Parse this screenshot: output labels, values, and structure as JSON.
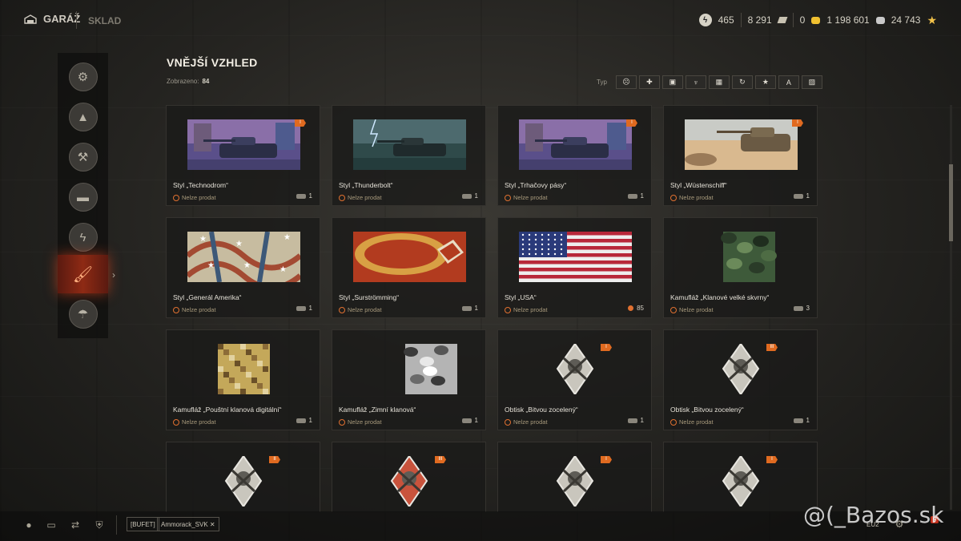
{
  "topbar": {
    "garage_label": "GARÁŽ",
    "storage_label": "SKLAD",
    "free_xp": "465",
    "bonds": "8 291",
    "credits_icon_value": "0",
    "gold": "1 198 601",
    "silver": "24 743"
  },
  "sidebar": {
    "items": [
      {
        "icon": "consumables-icon",
        "glyph": "⚙"
      },
      {
        "icon": "shells-icon",
        "glyph": "▲"
      },
      {
        "icon": "equipment-icon",
        "glyph": "⚒"
      },
      {
        "icon": "tank-icon",
        "glyph": "▬"
      },
      {
        "icon": "directive-icon",
        "glyph": "ϟ"
      },
      {
        "icon": "customization-brush-icon",
        "glyph": "🖌"
      },
      {
        "icon": "crew-parachute-icon",
        "glyph": "☂"
      }
    ],
    "active_index": 5
  },
  "main": {
    "title": "VNĚJŠÍ VZHLED",
    "shown_label": "Zobrazeno:",
    "shown_count": "84",
    "filter_label": "Typ",
    "filters": [
      "☹",
      "✚",
      "▣",
      "♆",
      "▦",
      "↻",
      "★",
      "A",
      "▨"
    ]
  },
  "cards": [
    {
      "name": "Styl „Technodrom“",
      "sell": "Nelze prodat",
      "count": "1",
      "badge": "I",
      "art": "tank-blue"
    },
    {
      "name": "Styl „Thunderbolt“",
      "sell": "Nelze prodat",
      "count": "1",
      "badge": "",
      "art": "storm"
    },
    {
      "name": "Styl „Trhačovy pásy“",
      "sell": "Nelze prodat",
      "count": "1",
      "badge": "I",
      "art": "tank-blue"
    },
    {
      "name": "Styl „Wüstenschiff“",
      "sell": "Nelze prodat",
      "count": "1",
      "badge": "I",
      "art": "desert"
    },
    {
      "name": "Styl „Generál Amerika“",
      "sell": "Nelze prodat",
      "count": "1",
      "badge": "",
      "art": "amerika"
    },
    {
      "name": "Styl „Surströmming“",
      "sell": "Nelze prodat",
      "count": "1",
      "badge": "",
      "art": "surstromming"
    },
    {
      "name": "Styl „USA“",
      "sell": "Nelze prodat",
      "count": "85",
      "badge": "",
      "art": "usa",
      "timer": true
    },
    {
      "name": "Kamufláž „Klanové velké skvrny“",
      "sell": "Nelze prodat",
      "count": "3",
      "badge": "",
      "art": "camo-green"
    },
    {
      "name": "Kamufláž „Pouštní klanová digitální“",
      "sell": "Nelze prodat",
      "count": "1",
      "badge": "",
      "art": "camo-desert"
    },
    {
      "name": "Kamufláž „Zimní klanová“",
      "sell": "Nelze prodat",
      "count": "1",
      "badge": "",
      "art": "camo-winter"
    },
    {
      "name": "Obtisk „Bitvou zocelený“",
      "sell": "Nelze prodat",
      "count": "1",
      "badge": "I",
      "art": "emblem"
    },
    {
      "name": "Obtisk „Bitvou zocelený“",
      "sell": "Nelze prodat",
      "count": "1",
      "badge": "III",
      "art": "emblem"
    },
    {
      "name": "",
      "sell": "",
      "count": "",
      "badge": "II",
      "art": "emblem"
    },
    {
      "name": "",
      "sell": "",
      "count": "",
      "badge": "III",
      "art": "emblem-red"
    },
    {
      "name": "",
      "sell": "",
      "count": "",
      "badge": "I",
      "art": "emblem"
    },
    {
      "name": "",
      "sell": "",
      "count": "",
      "badge": "I",
      "art": "emblem"
    }
  ],
  "bottombar": {
    "platoon_tag": "[BUFET]",
    "player_tag": "Ammorack_SVK ✕",
    "server": "EU2",
    "notifications": "9",
    "watermark": "@(_Bazos.sk"
  },
  "colors": {
    "accent_orange": "#e06a20",
    "active_red": "#8e2a14"
  }
}
